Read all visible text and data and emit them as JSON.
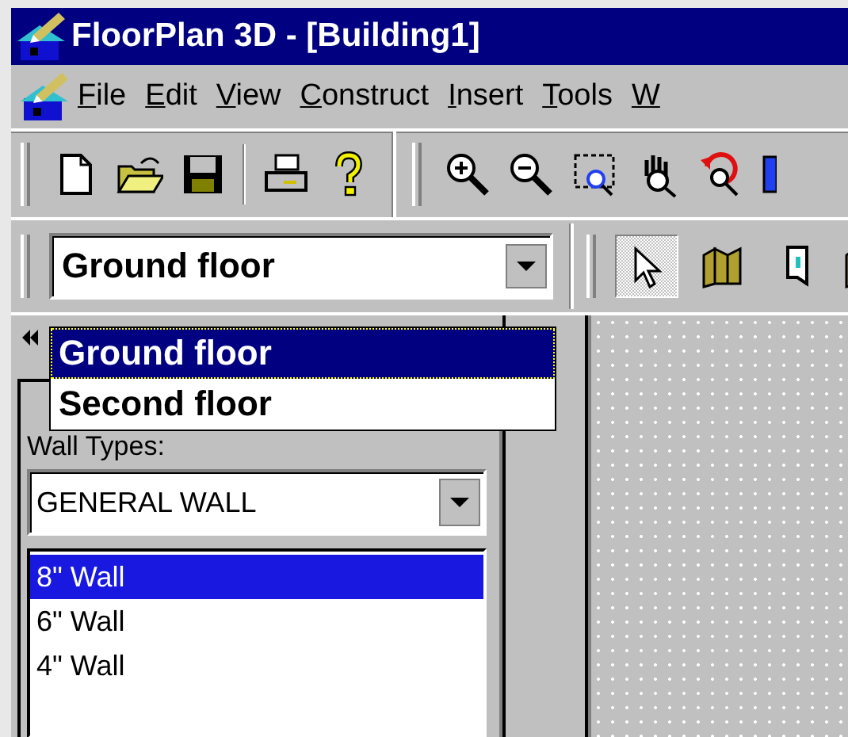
{
  "window": {
    "title": "FloorPlan 3D - [Building1]"
  },
  "menu": [
    "File",
    "Edit",
    "View",
    "Construct",
    "Insert",
    "Tools",
    "W"
  ],
  "toolbar": [
    {
      "kind": "new"
    },
    {
      "kind": "open"
    },
    {
      "kind": "save"
    },
    {
      "kind": "sep"
    },
    {
      "kind": "print"
    },
    {
      "kind": "help"
    },
    {
      "kind": "bar"
    },
    {
      "kind": "zoom-in"
    },
    {
      "kind": "zoom-out"
    },
    {
      "kind": "zoom-window"
    },
    {
      "kind": "pan"
    },
    {
      "kind": "zoom-undo"
    },
    {
      "kind": "partial"
    }
  ],
  "floor_select": {
    "value": "Ground floor",
    "options": [
      {
        "label": "Ground floor",
        "selected": true
      },
      {
        "label": "Second floor",
        "selected": false
      }
    ]
  },
  "tools": [
    {
      "kind": "pointer",
      "selected": true
    },
    {
      "kind": "wall",
      "selected": false
    },
    {
      "kind": "door",
      "selected": false
    },
    {
      "kind": "partial",
      "selected": false
    }
  ],
  "wall_panel": {
    "label": "Wall Types:",
    "category": "GENERAL WALL",
    "walls": [
      {
        "label": "8\" Wall",
        "selected": true
      },
      {
        "label": "6\" Wall",
        "selected": false
      },
      {
        "label": "4\" Wall",
        "selected": false
      }
    ]
  }
}
